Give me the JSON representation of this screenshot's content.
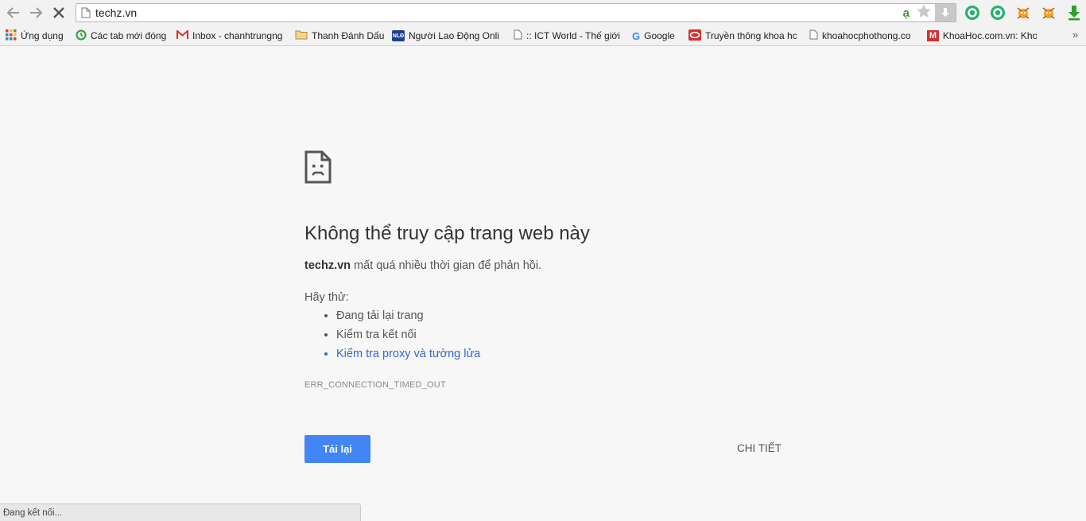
{
  "toolbar": {
    "url": "techz.vn",
    "page_icon": "page-icon",
    "icons": [
      "back-arrow-icon",
      "forward-arrow-icon",
      "stop-loading-icon",
      "star-icon",
      "download-icon"
    ],
    "input_method_indicator": "ạ",
    "extensions": [
      "extension-green-a-icon",
      "extension-green-a2-icon",
      "extension-bug-icon",
      "extension-bug2-icon",
      "download-arrow-icon"
    ]
  },
  "bookmarks": [
    {
      "label": "Ứng dụng",
      "icon": "apps-grid-icon"
    },
    {
      "label": "Các tab mới đóng",
      "icon": "history-icon"
    },
    {
      "label": "Inbox - chanhtrungng",
      "icon": "gmail-icon"
    },
    {
      "label": "Thanh Đánh Dấu",
      "icon": "folder-icon"
    },
    {
      "label": "Người Lao Động Onli",
      "icon": "nld-icon"
    },
    {
      "label": ":: ICT World - Thế giới",
      "icon": "page-icon"
    },
    {
      "label": "Google",
      "icon": "google-icon"
    },
    {
      "label": "Truyền thông khoa hc",
      "icon": "red-site-icon"
    },
    {
      "label": "khoahocphothong.co",
      "icon": "page-icon"
    },
    {
      "label": "KhoaHoc.com.vn: Kho",
      "icon": "khoahoc-icon"
    }
  ],
  "bookmarks_more": "»",
  "error": {
    "icon": "sad-page-icon",
    "title": "Không thể truy cập trang web này",
    "host": "techz.vn",
    "description": "mất quá nhiều thời gian để phản hồi.",
    "try_label": "Hãy thử:",
    "suggestions": [
      "Đang tải lại trang",
      "Kiểm tra kết nối",
      "Kiểm tra proxy và tường lửa"
    ],
    "code": "ERR_CONNECTION_TIMED_OUT",
    "reload_label": "Tải lại",
    "details_label": "CHI TIẾT"
  },
  "status": "Đang kết nối...",
  "colors": {
    "accent": "#4285f4",
    "link": "#3367d6",
    "background": "#f7f7f7"
  }
}
